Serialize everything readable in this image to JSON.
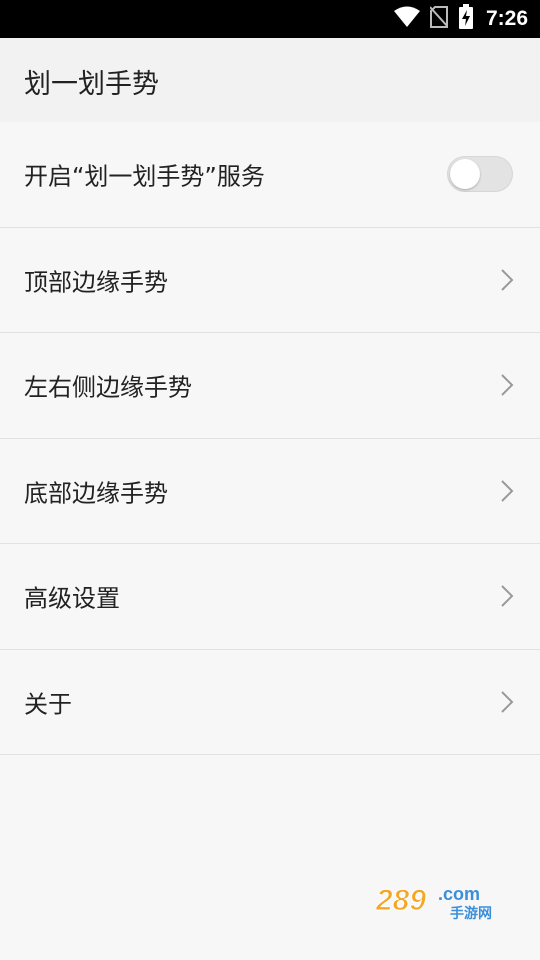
{
  "status_bar": {
    "time": "7:26",
    "icons": [
      "wifi-icon",
      "no-sim-icon",
      "battery-charging-icon"
    ]
  },
  "app_bar": {
    "title": "划一划手势"
  },
  "settings": {
    "service_toggle": {
      "label": "开启“划一划手势”服务",
      "enabled": false
    },
    "items": [
      {
        "label": "顶部边缘手势"
      },
      {
        "label": "左右侧边缘手势"
      },
      {
        "label": "底部边缘手势"
      },
      {
        "label": "高级设置"
      },
      {
        "label": "关于"
      }
    ]
  },
  "watermark": {
    "text": "289.com 手游网"
  },
  "colors": {
    "background": "#f7f7f7",
    "app_bar": "#f2f2f2",
    "text": "#222222",
    "divider": "#e2e2e2",
    "status_bar": "#000000",
    "watermark_orange": "#f5a623",
    "watermark_blue": "#3b8fd9"
  }
}
